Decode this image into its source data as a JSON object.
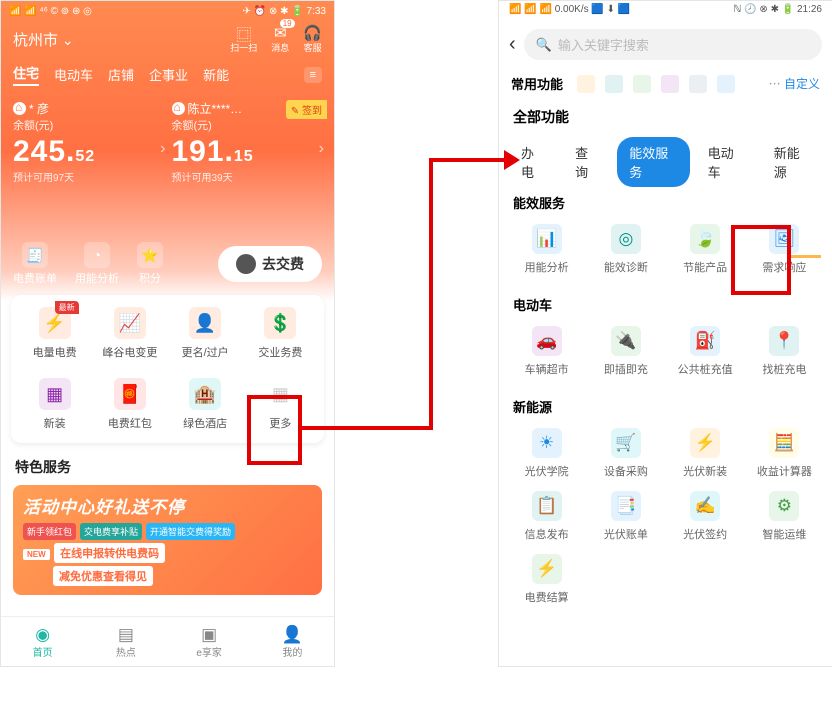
{
  "left": {
    "status": {
      "left": "📶 📶 ⁴⁶ © ⊚ ⊛ ◎",
      "right": "✈ ⏰ ⊗ ✱ 🔋 7:33"
    },
    "location": "杭州市",
    "topIcons": [
      {
        "g": "⿴",
        "l": "扫一扫"
      },
      {
        "g": "✉",
        "l": "消息",
        "b": "19"
      },
      {
        "g": "🎧",
        "l": "客服"
      }
    ],
    "tabs": [
      "住宅",
      "电动车",
      "店铺",
      "企事业",
      "新能"
    ],
    "menuBtn": "≡",
    "accounts": [
      {
        "name": "* 彦",
        "label": "余额(元)",
        "int": "245.",
        "dec": "52",
        "est": "预计可用97天"
      },
      {
        "name": "陈立****…",
        "label": "余额(元)",
        "int": "191.",
        "dec": "15",
        "est": "预计可用39天",
        "sign": "✎ 签到"
      }
    ],
    "actions": [
      {
        "i": "🧾",
        "l": "电费账单"
      },
      {
        "i": "◔",
        "l": "用能分析"
      },
      {
        "i": "⭐",
        "l": "积分"
      }
    ],
    "payBtn": "去交费",
    "grid": [
      {
        "i": "⚡",
        "l": "电量电费",
        "c": "ico-orange",
        "tag": "最新"
      },
      {
        "i": "📈",
        "l": "峰谷电变更",
        "c": "ico-orange"
      },
      {
        "i": "👤",
        "l": "更名/过户",
        "c": "ico-orange"
      },
      {
        "i": "💲",
        "l": "交业务费",
        "c": "ico-orange"
      },
      {
        "i": "▦",
        "l": "新装",
        "c": "ico-purple"
      },
      {
        "i": "🧧",
        "l": "电费红包",
        "c": "ico-red"
      },
      {
        "i": "🏨",
        "l": "绿色酒店",
        "c": "ico-teal"
      },
      {
        "i": "▦",
        "l": "更多",
        "c": "ico-grey"
      }
    ],
    "specialH": "特色服务",
    "banner": {
      "title": "活动中心好礼送不停",
      "tags": [
        "新手领红包",
        "交电费享补贴",
        "开通智能交费得奖励"
      ],
      "new": "NEW",
      "l1": "在线申报转供电费码",
      "l2": "减免优惠查看得见"
    },
    "nav": [
      {
        "i": "◉",
        "l": "首页"
      },
      {
        "i": "▤",
        "l": "热点"
      },
      {
        "i": "▣",
        "l": "e享家"
      },
      {
        "i": "👤",
        "l": "我的"
      }
    ]
  },
  "right": {
    "status": {
      "left": "📶 📶 📶 0.00K/s 🟦 ⬇ 🟦",
      "right": "ℕ 🕗 ⊗ ✱ 🔋 21:26"
    },
    "searchPh": "输入关键字搜索",
    "freqLabel": "常用功能",
    "freqIcons": [
      "c-orange",
      "c-teal",
      "c-green",
      "c-purple",
      "c-grey",
      "c-blue"
    ],
    "custom": "自定义",
    "allH": "全部功能",
    "tabs": [
      "办电",
      "查询",
      "能效服务",
      "电动车",
      "新能源"
    ],
    "tabActive": 2,
    "sections": [
      {
        "h": "能效服务",
        "items": [
          {
            "i": "📊",
            "l": "用能分析",
            "c": "c-blue"
          },
          {
            "i": "◎",
            "l": "能效诊断",
            "c": "c-teal"
          },
          {
            "i": "🍃",
            "l": "节能产品",
            "c": "c-green"
          },
          {
            "i": "🖼",
            "l": "需求响应",
            "c": "c-blue"
          }
        ]
      },
      {
        "h": "电动车",
        "items": [
          {
            "i": "🚗",
            "l": "车辆超市",
            "c": "c-purple"
          },
          {
            "i": "🔌",
            "l": "即插即充",
            "c": "c-green"
          },
          {
            "i": "⛽",
            "l": "公共桩充值",
            "c": "c-blue"
          },
          {
            "i": "📍",
            "l": "找桩充电",
            "c": "c-teal"
          }
        ]
      },
      {
        "h": "新能源",
        "items": [
          {
            "i": "☀",
            "l": "光伏学院",
            "c": "c-blue"
          },
          {
            "i": "🛒",
            "l": "设备采购",
            "c": "c-cyan"
          },
          {
            "i": "⚡",
            "l": "光伏新装",
            "c": "c-orange"
          },
          {
            "i": "🧮",
            "l": "收益计算器",
            "c": "c-yellow"
          },
          {
            "i": "📋",
            "l": "信息发布",
            "c": "c-teal"
          },
          {
            "i": "📑",
            "l": "光伏账单",
            "c": "c-blue"
          },
          {
            "i": "✍",
            "l": "光伏签约",
            "c": "c-cyan"
          },
          {
            "i": "⚙",
            "l": "智能运维",
            "c": "c-green"
          },
          {
            "i": "⚡",
            "l": "电费结算",
            "c": "c-green"
          }
        ]
      }
    ]
  }
}
